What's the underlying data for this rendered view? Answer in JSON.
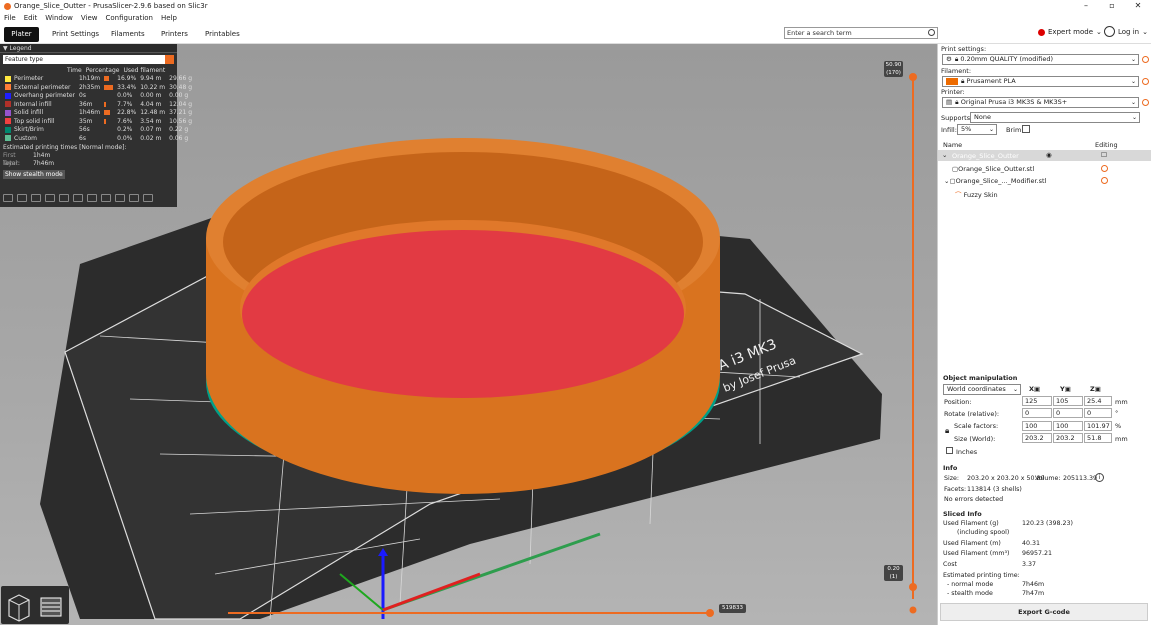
{
  "window": {
    "title": "Orange_Slice_Outter - PrusaSlicer-2.9.6 based on Slic3r",
    "min": "–",
    "max": "▫",
    "close": "✕"
  },
  "menu": [
    "File",
    "Edit",
    "Window",
    "View",
    "Configuration",
    "Help"
  ],
  "tabs": [
    "Plater",
    "Print Settings",
    "Filaments",
    "Printers",
    "Printables"
  ],
  "search": {
    "placeholder": "Enter a search term"
  },
  "mode": {
    "label": "Expert mode",
    "color": "#dd0000"
  },
  "login": {
    "label": "Log in"
  },
  "legend": {
    "title": "Legend",
    "feature": "Feature type",
    "headers": {
      "time": "Time",
      "pct": "Percentage",
      "used": "Used filament"
    },
    "rows": [
      {
        "name": "Perimeter",
        "color": "#ffe840",
        "time": "1h19m",
        "pct": "16.9%",
        "pctv": 16.9,
        "m": "9.94 m",
        "g": "29.66 g"
      },
      {
        "name": "External perimeter",
        "color": "#ff7d38",
        "time": "2h35m",
        "pct": "33.4%",
        "pctv": 33.4,
        "m": "10.22 m",
        "g": "30.48 g"
      },
      {
        "name": "Overhang perimeter",
        "color": "#1f1fff",
        "time": "0s",
        "pct": "0.0%",
        "pctv": 0,
        "m": "0.00 m",
        "g": "0.00 g"
      },
      {
        "name": "Internal infill",
        "color": "#b03029",
        "time": "36m",
        "pct": "7.7%",
        "pctv": 7.7,
        "m": "4.04 m",
        "g": "12.04 g"
      },
      {
        "name": "Solid infill",
        "color": "#9654cc",
        "time": "1h46m",
        "pct": "22.8%",
        "pctv": 22.8,
        "m": "12.48 m",
        "g": "37.21 g"
      },
      {
        "name": "Top solid infill",
        "color": "#f04040",
        "time": "35m",
        "pct": "7.6%",
        "pctv": 7.6,
        "m": "3.54 m",
        "g": "10.56 g"
      },
      {
        "name": "Skirt/Brim",
        "color": "#00876e",
        "time": "56s",
        "pct": "0.2%",
        "pctv": 0.2,
        "m": "0.07 m",
        "g": "0.22 g"
      },
      {
        "name": "Custom",
        "color": "#5ebd94",
        "time": "6s",
        "pct": "0.0%",
        "pctv": 0,
        "m": "0.02 m",
        "g": "0.06 g"
      }
    ],
    "est": "Estimated printing times [Normal mode]:",
    "first_layer_label": "First layer:",
    "first_layer": "1h4m",
    "total_label": "Total:",
    "total": "7h46m",
    "stealth": "Show stealth mode"
  },
  "vslider": {
    "top": "50.90",
    "top2": "(170)",
    "bot": "0.20",
    "bot2": "(1)"
  },
  "hslider": {
    "val": "519833"
  },
  "bed": {
    "brand": "SA i3 MK3",
    "sub": "by Josef Prusa"
  },
  "right": {
    "print_label": "Print settings:",
    "print": "0.20mm QUALITY (modified)",
    "fil_label": "Filament:",
    "fil": "Prusament PLA",
    "fil_color": "#ed6b00",
    "printer_label": "Printer:",
    "printer": "Original Prusa i3 MK3S & MK3S+",
    "supports_label": "Supports:",
    "supports": "None",
    "infill_label": "Infill:",
    "infill": "5%",
    "brim_label": "Brim:",
    "col_name": "Name",
    "col_editing": "Editing",
    "obj": "Orange_Slice_Outter",
    "items": [
      "Orange_Slice_Outter.stl",
      "Orange_Slice_..._Modifier.stl",
      "Fuzzy Skin"
    ],
    "om": "Object manipulation",
    "coords": "World coordinates",
    "x": "X",
    "y": "Y",
    "z": "Z",
    "pos_label": "Position:",
    "pos": [
      "125",
      "105",
      "25.4"
    ],
    "pos_unit": "mm",
    "rot_label": "Rotate (relative):",
    "rot": [
      "0",
      "0",
      "0"
    ],
    "rot_unit": "°",
    "scale_label": "Scale factors:",
    "scale": [
      "100",
      "100",
      "101.97"
    ],
    "scale_unit": "%",
    "size_label": "Size (World):",
    "size": [
      "203.2",
      "203.2",
      "51.8"
    ],
    "size_unit": "mm",
    "inches": "Inches",
    "info": "Info",
    "size_k": "Size:",
    "size_v": "203.20 x 203.20 x 50.80",
    "vol_k": "Volume:",
    "vol_v": "205113.39",
    "facets_k": "Facets:",
    "facets_v": "113814 (3 shells)",
    "no_err": "No errors detected",
    "sliced": "Sliced Info",
    "ug_k": "Used Filament (g)",
    "ug_v": "120.23 (398.23)",
    "spool": "(including spool)",
    "um_k": "Used Filament (m)",
    "um_v": "40.31",
    "umm_k": "Used Filament (mm³)",
    "umm_v": "96957.21",
    "cost_k": "Cost",
    "cost_v": "3.37",
    "est_k": "Estimated printing time:",
    "normal_k": "- normal mode",
    "normal_v": "7h46m",
    "stealth_k": "- stealth mode",
    "stealth_v": "7h47m",
    "export": "Export G-code"
  }
}
